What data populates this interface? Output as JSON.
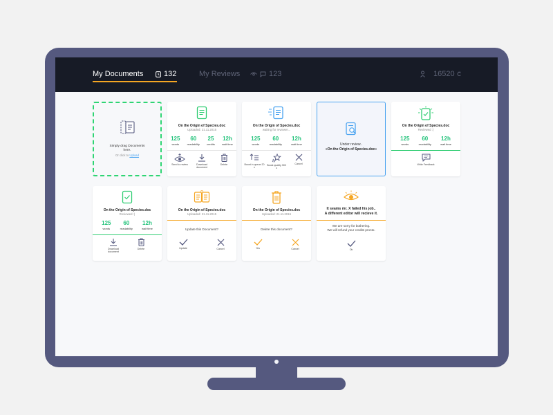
{
  "header": {
    "tab_documents": "My Documents",
    "documents_count": "132",
    "tab_reviews": "My Reviews",
    "reviews_count": "123",
    "credits": "16520"
  },
  "colors": {
    "accent": "#f5a623",
    "green": "#22c27a",
    "blue": "#4aa3f0",
    "topbar": "#171b26",
    "monitor": "#55597f"
  },
  "upload": {
    "line1": "Simply drag Documents",
    "line2": "here.",
    "or_click": "Or click to",
    "link": "Upload"
  },
  "stat_labels": {
    "words": "words",
    "readability": "readability",
    "credits": "credits",
    "wait_time": "wait time"
  },
  "cards": {
    "uploaded": {
      "title": "On the Origin of Species.doc",
      "subtitle": "Uploaded: 21.11.2015",
      "words": "125",
      "readability": "60",
      "credits": "25",
      "wait": "12h",
      "action_review": "Send to review",
      "action_download": "Download document",
      "action_delete": "Delete"
    },
    "waiting": {
      "title": "On the Origin of Species.doc",
      "subtitle": "waiting for reviewer...",
      "words": "125",
      "readability": "60",
      "wait": "12h",
      "action_boost_queue": "Boost in queue 20 c",
      "action_boost_quality": "Boost quality 300 c",
      "action_cancel": "Cancel"
    },
    "under_review": {
      "text": "Under review..",
      "doc": "«On the Origin of Species.doc»"
    },
    "reviewed_feedback": {
      "title": "On the Origin of Species.doc",
      "subtitle": "Reviewed :)",
      "words": "125",
      "readability": "60",
      "wait": "12h",
      "action_feedback": "Write Feedback"
    },
    "reviewed_download": {
      "title": "On the Origin of Species.doc",
      "subtitle": "Reviewed :)",
      "words": "125",
      "readability": "60",
      "wait": "12h",
      "action_download": "Download document",
      "action_delete": "Delete"
    },
    "update": {
      "title": "On the Origin of Species.doc",
      "subtitle": "Uploaded: 21.11.2015",
      "question": "Update this Document?",
      "action_update": "Update",
      "action_cancel": "Cancel"
    },
    "delete": {
      "title": "On the Origin of Species.doc",
      "subtitle": "Uploaded: 21.11.2015",
      "question": "Delete this document?",
      "action_yes": "Yes",
      "action_cancel": "Cancel"
    },
    "failed": {
      "line1": "It seams mr. X failed his job..",
      "line2": "A different editor will recieve it.",
      "msg1": "We are sorry for bothering.",
      "msg2": "We will refund your credits pronto.",
      "action_ok": "Ok"
    }
  }
}
